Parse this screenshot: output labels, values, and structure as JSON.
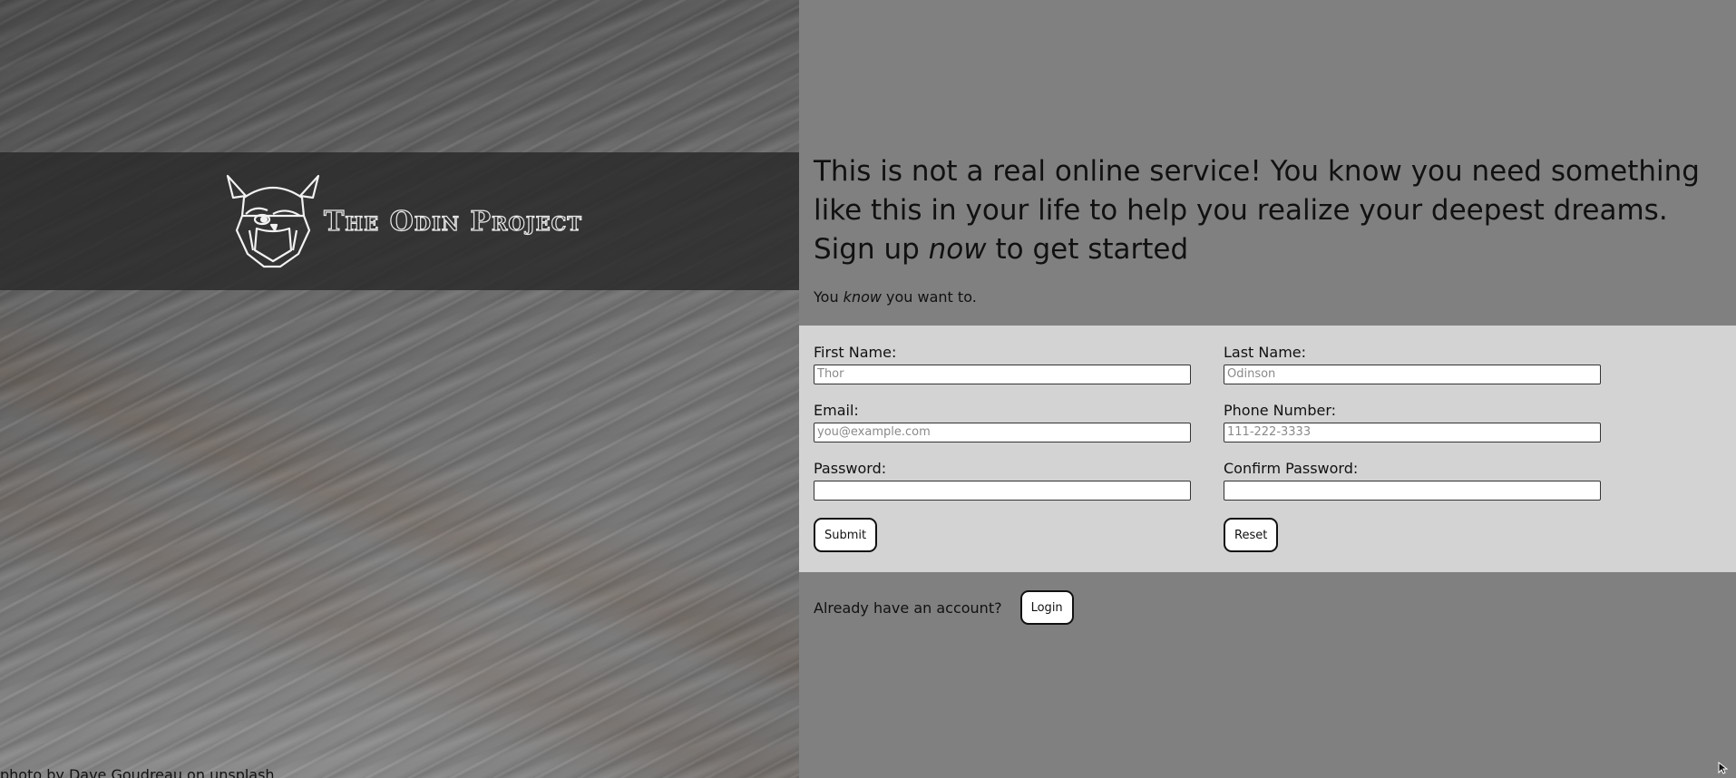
{
  "logo": {
    "text": "The Odin Project"
  },
  "photo_credit": "photo by Dave Goudreau on unsplash",
  "headline": {
    "part1": "This is not a real online service! You know you need something like this in your life to help you realize your deepest dreams. Sign up ",
    "emphasis": "now",
    "part2": " to get started"
  },
  "subline": {
    "prefix": "You ",
    "emphasis": "know",
    "suffix": " you want to."
  },
  "form": {
    "first_name": {
      "label": "First Name:",
      "placeholder": "Thor"
    },
    "last_name": {
      "label": "Last Name:",
      "placeholder": "Odinson"
    },
    "email": {
      "label": "Email:",
      "placeholder": "you@example.com"
    },
    "phone": {
      "label": "Phone Number:",
      "placeholder": "111-222-3333"
    },
    "password": {
      "label": "Password:",
      "placeholder": ""
    },
    "confirm_password": {
      "label": "Confirm Password:",
      "placeholder": ""
    },
    "submit_label": "Submit",
    "reset_label": "Reset"
  },
  "account": {
    "text": "Already have an account?",
    "login_label": "Login"
  },
  "colors": {
    "background": "#808080",
    "form_band": "#d3d3d3",
    "logo_band": "#282828"
  }
}
